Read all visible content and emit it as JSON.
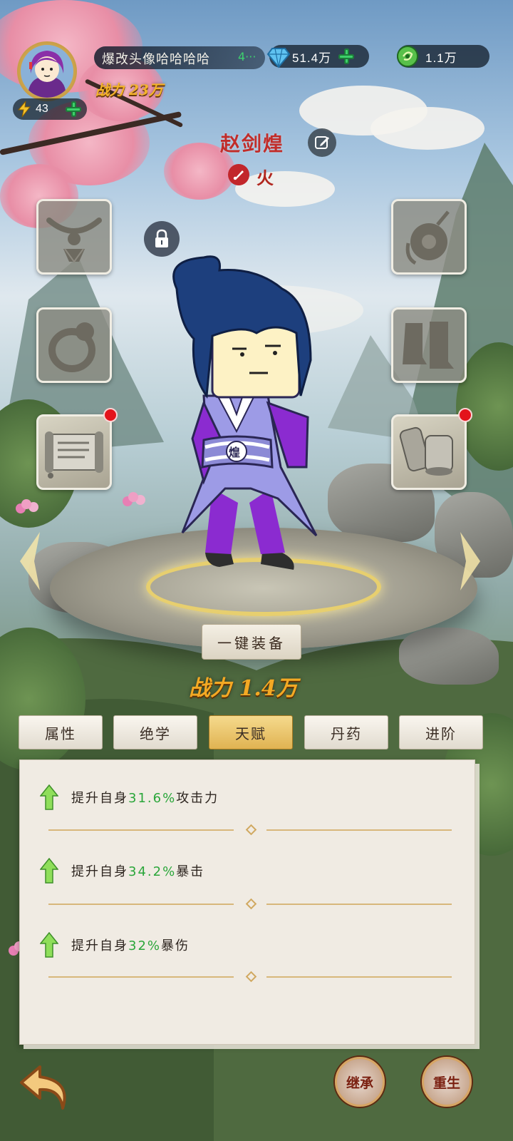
{
  "player": {
    "nickname": "爆改头像哈哈哈哈",
    "nickname_suffix": "4···",
    "power_label": "战力 23万",
    "energy": "43"
  },
  "resources": {
    "diamond": "51.4万",
    "jade": "1.1万"
  },
  "character": {
    "name": "赵剑煌",
    "element": "火",
    "belt_emblem": "煌"
  },
  "equipment": {
    "slots": [
      {
        "slot": "necklace",
        "icon": "necklace-icon",
        "filled": false,
        "side": "left"
      },
      {
        "slot": "ring",
        "icon": "ring-icon",
        "filled": false,
        "side": "left"
      },
      {
        "slot": "scroll",
        "icon": "scroll-icon",
        "filled": true,
        "side": "left",
        "badge": true
      },
      {
        "slot": "pendant",
        "icon": "jade-pendant-icon",
        "filled": false,
        "side": "right"
      },
      {
        "slot": "boots",
        "icon": "boots-icon",
        "filled": false,
        "side": "right"
      },
      {
        "slot": "manual",
        "icon": "scroll-bundle-icon",
        "filled": true,
        "side": "right",
        "badge": true
      }
    ],
    "one_click_label": "一键装备"
  },
  "power_main": "战力 1.4万",
  "tabs": [
    {
      "label": "属性",
      "active": false
    },
    {
      "label": "绝学",
      "active": false
    },
    {
      "label": "天赋",
      "active": true
    },
    {
      "label": "丹药",
      "active": false
    },
    {
      "label": "进阶",
      "active": false
    }
  ],
  "talents": [
    {
      "prefix": "提升自身",
      "value": "31.6%",
      "suffix": "攻击力"
    },
    {
      "prefix": "提升自身",
      "value": "34.2%",
      "suffix": "暴击"
    },
    {
      "prefix": "提升自身",
      "value": "32%",
      "suffix": "暴伤"
    }
  ],
  "bottom": {
    "inherit_label": "继承",
    "rebirth_label": "重生"
  },
  "colors": {
    "accent_gold": "#e0b352",
    "name_red": "#c12d2a",
    "highlight_green": "#2aa63a",
    "badge_red": "#e3131b"
  }
}
